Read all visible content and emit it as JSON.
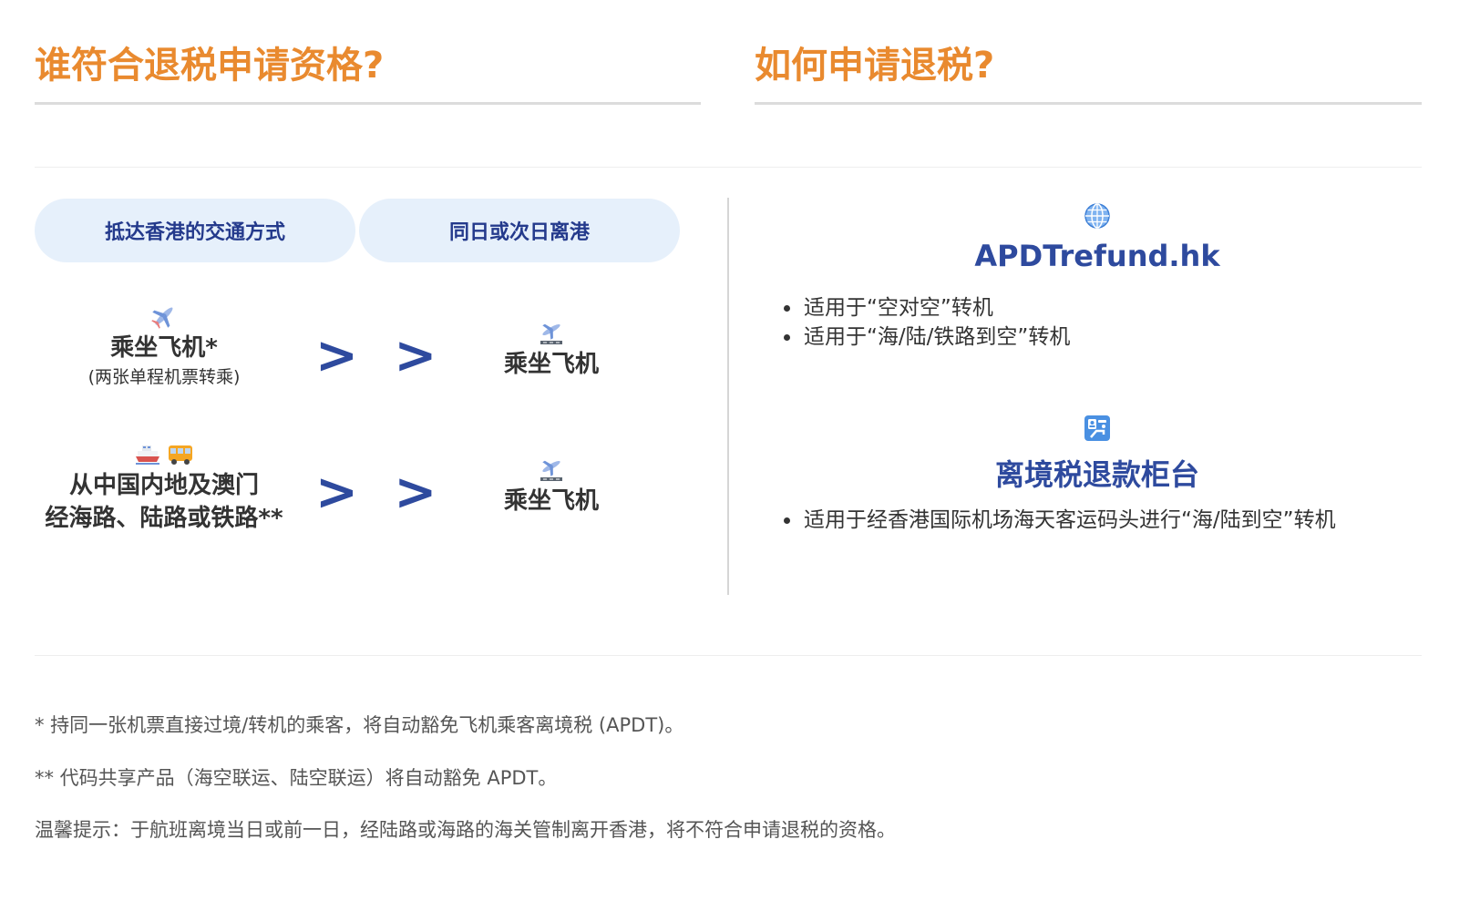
{
  "left_section": {
    "heading": "谁符合退税申请资格?",
    "pills": [
      "抵达香港的交通方式",
      "同日或次日离港"
    ],
    "rows": [
      {
        "arrival": {
          "icons": [
            "airplane-icon"
          ],
          "title_lines": [
            "乘坐飞机*"
          ],
          "subtitle": "(两张单程机票转乘)"
        },
        "arrow": "> >",
        "departure": {
          "icon": "departing-plane-icon",
          "title": "乘坐飞机"
        }
      },
      {
        "arrival": {
          "icons": [
            "ferry-icon",
            "bus-icon"
          ],
          "title_lines": [
            "从中国内地及澳门",
            "经海路、陆路或铁路**"
          ],
          "subtitle": ""
        },
        "arrow": "> >",
        "departure": {
          "icon": "departing-plane-icon",
          "title": "乘坐飞机"
        }
      }
    ]
  },
  "right_section": {
    "heading": "如何申请退税?",
    "methods": [
      {
        "icon": "globe-icon",
        "title": "APDTrefund.hk",
        "bullets": [
          "适用于“空对空”转机",
          "适用于“海/陆/铁路到空”转机"
        ]
      },
      {
        "icon": "passport-control-icon",
        "title": "离境税退款柜台",
        "bullets": [
          "适用于经香港国际机场海天客运码头进行“海/陆到空”转机"
        ]
      }
    ]
  },
  "footnotes": [
    "* 持同一张机票直接过境/转机的乘客，将自动豁免飞机乘客离境税 (APDT)。",
    "** 代码共享产品（海空联运、陆空联运）将自动豁免 APDT。",
    "温馨提示：于航班离境当日或前一日，经陆路或海路的海关管制离开香港，将不符合申请退税的资格。"
  ],
  "colors": {
    "heading": "#E98A2F",
    "accent": "#2E4A9E",
    "pill_bg": "#E6F0FB",
    "pill_text": "#243A8C"
  }
}
